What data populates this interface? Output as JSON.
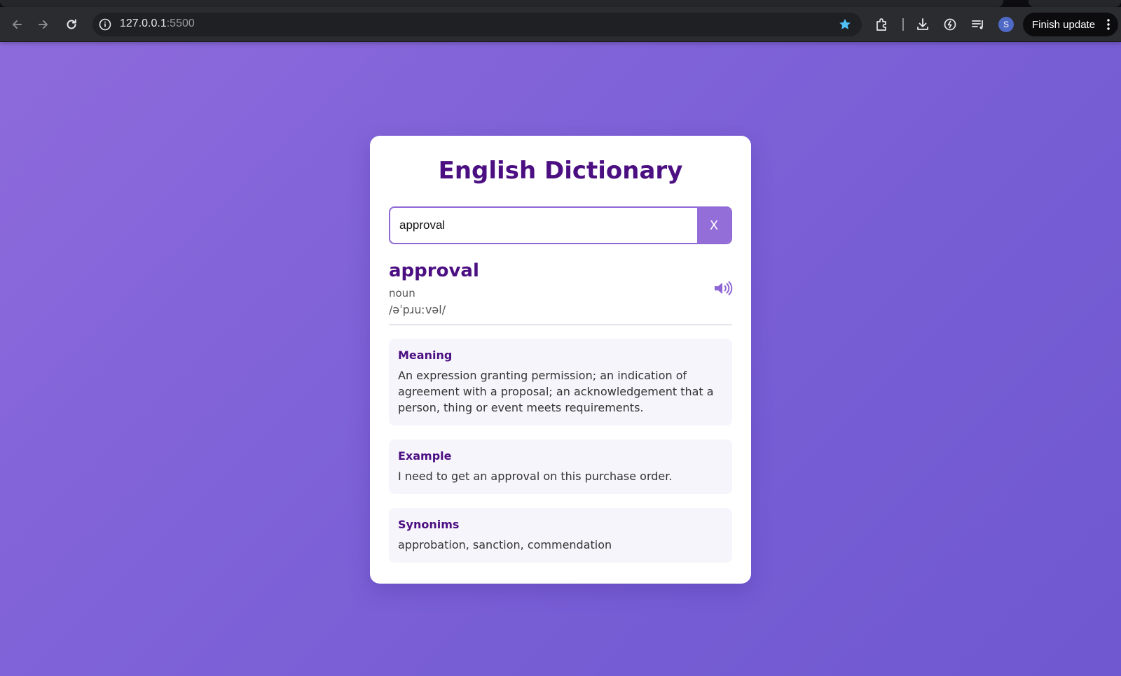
{
  "browser": {
    "url_host": "127.0.0.1",
    "url_port": ":5500",
    "update_label": "Finish update",
    "avatar_letter": "S",
    "icons": [
      "back-icon",
      "forward-icon",
      "reload-icon",
      "info-icon",
      "star-icon",
      "extensions-icon",
      "download-icon",
      "performance-icon",
      "reading-list-icon",
      "menu-dots-icon"
    ],
    "accent": "#4fc3f7"
  },
  "app": {
    "title": "English Dictionary",
    "search": {
      "value": "approval",
      "clear_label": "X"
    },
    "result": {
      "word": "approval",
      "part_of_speech": "noun",
      "phonetic": "/əˈpɹuːvəl/",
      "audio_icon": "speaker-icon"
    },
    "sections": {
      "meaning": {
        "heading": "Meaning",
        "text": "An expression granting permission; an indication of agreement with a proposal; an acknowledgement that a person, thing or event meets requirements."
      },
      "example": {
        "heading": "Example",
        "text": "I need to get an approval on this purchase order."
      },
      "synonyms": {
        "heading": "Synonims",
        "text": "approbation, sanction, commendation"
      }
    }
  },
  "colors": {
    "background_start": "#8e6bdc",
    "background_end": "#6f58d0",
    "title": "#4b0f82",
    "button": "#946ed8",
    "section_bg": "#f7f5fc"
  }
}
